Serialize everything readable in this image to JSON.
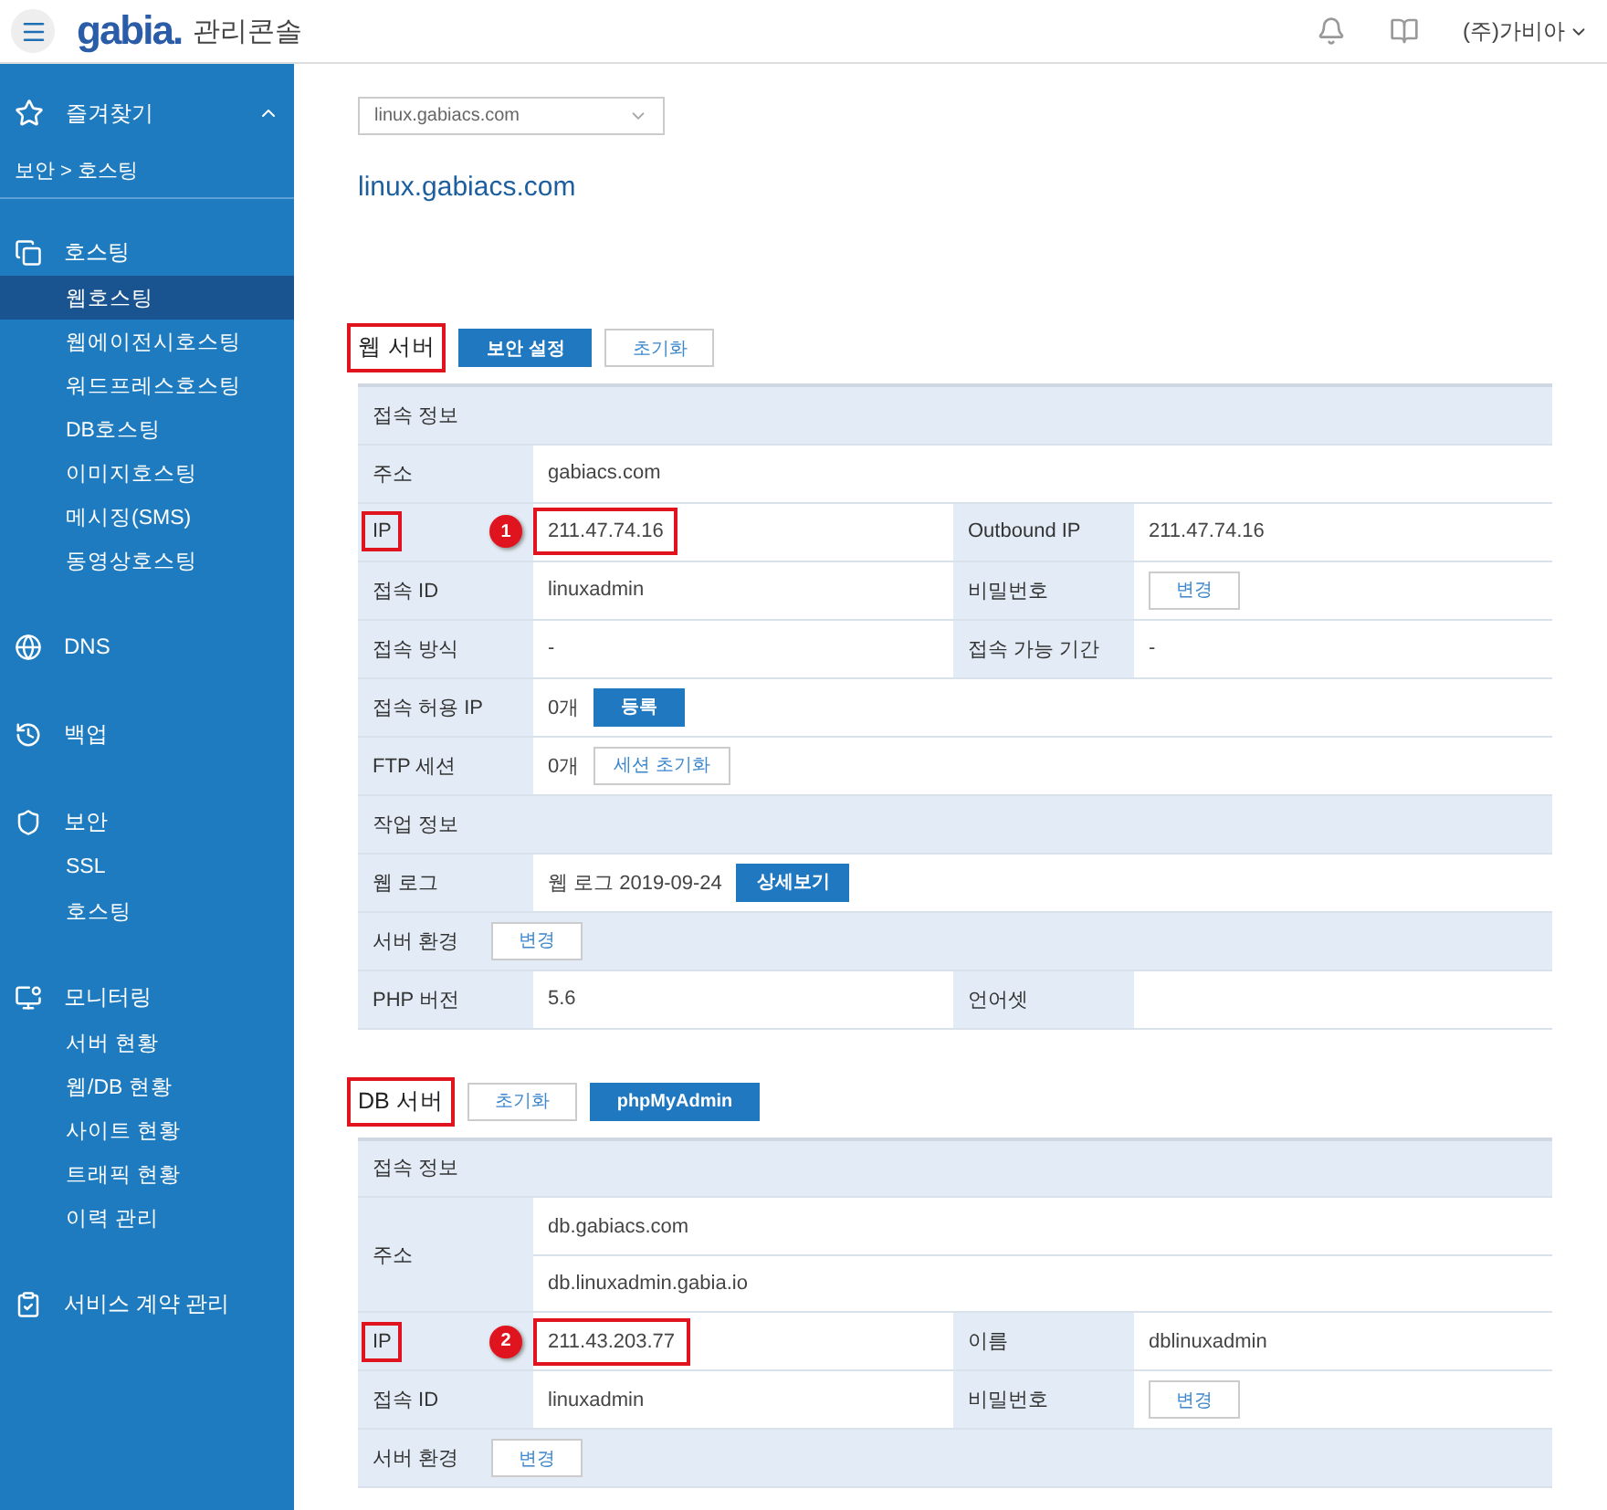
{
  "topbar": {
    "logo": "gabia.",
    "app_name": "관리콘솔",
    "account": "(주)가비아"
  },
  "sidebar": {
    "favorites": {
      "label": "즐겨찾기",
      "expanded": true
    },
    "breadcrumb": "보안 > 호스팅",
    "groups": [
      {
        "label": "호스팅",
        "items": [
          {
            "label": "웹호스팅",
            "selected": true
          },
          {
            "label": "웹에이전시호스팅",
            "selected": false
          },
          {
            "label": "워드프레스호스팅",
            "selected": false
          },
          {
            "label": "DB호스팅",
            "selected": false
          },
          {
            "label": "이미지호스팅",
            "selected": false
          },
          {
            "label": "메시징(SMS)",
            "selected": false
          },
          {
            "label": "동영상호스팅",
            "selected": false
          }
        ]
      },
      {
        "label": "DNS"
      },
      {
        "label": "백업"
      },
      {
        "label": "보안",
        "items": [
          {
            "label": "SSL",
            "selected": false
          },
          {
            "label": "호스팅",
            "selected": false
          }
        ]
      },
      {
        "label": "모니터링",
        "items": [
          {
            "label": "서버 현황",
            "selected": false
          },
          {
            "label": "웹/DB 현황",
            "selected": false
          },
          {
            "label": "사이트 현황",
            "selected": false
          },
          {
            "label": "트래픽 현황",
            "selected": false
          },
          {
            "label": "이력 관리",
            "selected": false
          }
        ]
      },
      {
        "label": "서비스 계약 관리"
      }
    ]
  },
  "domain_select": {
    "value": "linux.gabiacs.com"
  },
  "page_title": "linux.gabiacs.com",
  "sections": [
    {
      "title": "웹 서버",
      "highlighted": true,
      "buttons": [
        {
          "label": "보안 설정",
          "kind": "primary"
        },
        {
          "label": "초기화",
          "kind": "outline"
        }
      ],
      "rows": [
        {
          "kind": "header",
          "label": "접속 정보"
        },
        {
          "kind": "field",
          "label": "주소",
          "values": [
            {
              "text": "gabiacs.com"
            }
          ]
        },
        {
          "kind": "field",
          "label": "IP",
          "highlighted": true,
          "marker": "1",
          "values": [
            {
              "text": "211.47.74.16",
              "highlighted": true
            }
          ],
          "side": {
            "label": "Outbound IP",
            "values": [
              {
                "text": "211.47.74.16"
              }
            ]
          }
        },
        {
          "kind": "field",
          "label": "접속 ID",
          "values": [
            {
              "text": "linuxadmin"
            }
          ],
          "side": {
            "label": "비밀번호",
            "values": [
              {
                "button": {
                  "label": "변경",
                  "kind": "outline"
                }
              }
            ]
          }
        },
        {
          "kind": "field",
          "label": "접속 방식",
          "values": [
            {
              "text": "-"
            }
          ],
          "side": {
            "label": "접속 가능 기간",
            "values": [
              {
                "text": "-"
              }
            ]
          }
        },
        {
          "kind": "field",
          "label": "접속 허용 IP",
          "values": [
            {
              "text": "0개",
              "button": {
                "label": "등록",
                "kind": "primary"
              }
            }
          ]
        },
        {
          "kind": "field",
          "label": "FTP 세션",
          "values": [
            {
              "text": "0개",
              "button": {
                "label": "세션 초기화",
                "kind": "outline"
              }
            }
          ]
        },
        {
          "kind": "header",
          "label": "작업 정보"
        },
        {
          "kind": "field",
          "label": "웹 로그",
          "values": [
            {
              "text": "웹 로그 2019-09-24",
              "button": {
                "label": "상세보기",
                "kind": "primary"
              }
            }
          ]
        },
        {
          "kind": "action",
          "label": "서버 환경",
          "button": {
            "label": "변경",
            "kind": "outline"
          }
        },
        {
          "kind": "field",
          "label": "PHP 버전",
          "values": [
            {
              "text": "5.6"
            }
          ],
          "side": {
            "label": "언어셋"
          }
        }
      ]
    },
    {
      "title": "DB 서버",
      "highlighted": true,
      "buttons": [
        {
          "label": "초기화",
          "kind": "outline"
        },
        {
          "label": "phpMyAdmin",
          "kind": "primary"
        }
      ],
      "rows": [
        {
          "kind": "header",
          "label": "접속 정보"
        },
        {
          "kind": "field",
          "label": "주소",
          "values": [
            {
              "text": "db.gabiacs.com"
            },
            {
              "text": "db.linuxadmin.gabia.io"
            }
          ]
        },
        {
          "kind": "field",
          "label": "IP",
          "highlighted": true,
          "marker": "2",
          "values": [
            {
              "text": "211.43.203.77",
              "highlighted": true
            }
          ],
          "side": {
            "label": "이름",
            "values": [
              {
                "text": "dblinuxadmin"
              }
            ]
          }
        },
        {
          "kind": "field",
          "label": "접속 ID",
          "values": [
            {
              "text": "linuxadmin"
            }
          ],
          "side": {
            "label": "비밀번호",
            "values": [
              {
                "button": {
                  "label": "변경",
                  "kind": "outline"
                }
              }
            ]
          }
        },
        {
          "kind": "action",
          "label": "서버 환경",
          "button": {
            "label": "변경",
            "kind": "outline"
          }
        }
      ]
    }
  ]
}
